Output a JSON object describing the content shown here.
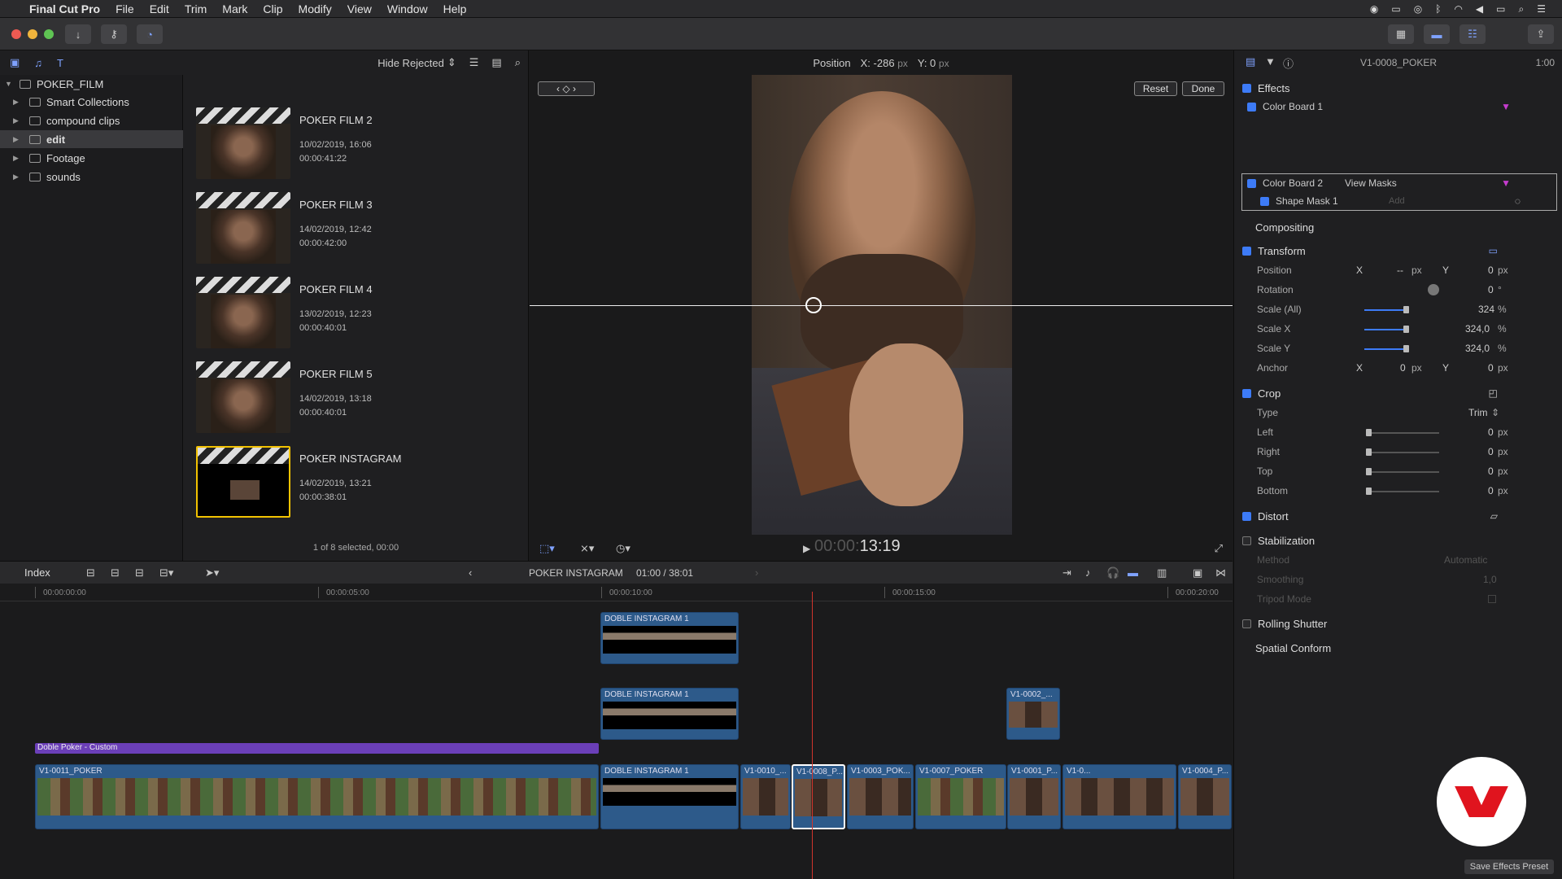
{
  "menubar": {
    "items": [
      "Final Cut Pro",
      "File",
      "Edit",
      "Trim",
      "Mark",
      "Clip",
      "Modify",
      "View",
      "Window",
      "Help"
    ]
  },
  "browser": {
    "filter_label": "Hide Rejected",
    "library": {
      "root": "POKER_FILM",
      "items": [
        "Smart Collections",
        "compound clips",
        "edit",
        "Footage",
        "sounds"
      ],
      "selected": "edit"
    },
    "clips": [
      {
        "title": "POKER FILM 2",
        "date": "10/02/2019, 16:06",
        "duration": "00:00:41:22"
      },
      {
        "title": "POKER FILM 3",
        "date": "14/02/2019, 12:42",
        "duration": "00:00:42:00"
      },
      {
        "title": "POKER FILM 4",
        "date": "13/02/2019, 12:23",
        "duration": "00:00:40:01"
      },
      {
        "title": "POKER FILM 5",
        "date": "14/02/2019, 13:18",
        "duration": "00:00:40:01"
      },
      {
        "title": "POKER INSTAGRAM",
        "date": "14/02/2019, 13:21",
        "duration": "00:00:38:01"
      }
    ],
    "footer": "1 of 8 selected, 00:00"
  },
  "viewer": {
    "param_label": "Position",
    "x_label": "X: -286",
    "x_unit": "px",
    "y_label": "Y: 0",
    "y_unit": "px",
    "reset_label": "Reset",
    "done_label": "Done",
    "timecode_dim": "00:00:",
    "timecode": "13:19"
  },
  "inspector": {
    "clip_name": "V1-0008_POKER",
    "time": "1:00",
    "effects_label": "Effects",
    "color_board_1": "Color Board 1",
    "color_board_2": "Color Board 2",
    "view_masks": "View Masks",
    "shape_mask": "Shape Mask 1",
    "add_label": "Add",
    "compositing": "Compositing",
    "transform": "Transform",
    "position": "Position",
    "x": "X",
    "y": "Y",
    "pos_x": "--",
    "pos_y": "0",
    "rotation": "Rotation",
    "rotation_val": "0",
    "deg": "°",
    "scale_all": "Scale (All)",
    "scale_all_val": "324",
    "scale_x": "Scale X",
    "scale_x_val": "324,0",
    "scale_y": "Scale Y",
    "scale_y_val": "324,0",
    "pct": "%",
    "px": "px",
    "anchor": "Anchor",
    "anchor_x": "0",
    "anchor_y": "0",
    "crop": "Crop",
    "type": "Type",
    "type_val": "Trim",
    "left": "Left",
    "right": "Right",
    "top": "Top",
    "bottom": "Bottom",
    "zero": "0",
    "distort": "Distort",
    "stabilization": "Stabilization",
    "method": "Method",
    "method_val": "Automatic",
    "smoothing": "Smoothing",
    "smoothing_val": "1,0",
    "tripod": "Tripod Mode",
    "rolling": "Rolling Shutter",
    "spatial": "Spatial Conform",
    "save_preset": "Save Effects Preset"
  },
  "timeline": {
    "index_label": "Index",
    "project": "POKER INSTAGRAM",
    "duration": "01:00 / 38:01",
    "ruler": [
      "00:00:00:00",
      "00:00:05:00",
      "00:00:10:00",
      "00:00:15:00",
      "00:00:20:00"
    ],
    "title_clip": "Doble Poker - Custom",
    "clips": {
      "c_doble1": "DOBLE INSTAGRAM 1",
      "c_doble2": "DOBLE INSTAGRAM 1",
      "c_doble3": "DOBLE INSTAGRAM 1",
      "c_0011": "V1-0011_POKER",
      "c_0010": "V1-0010_...",
      "c_0008": "V1-0008_P...",
      "c_0003": "V1-0003_POK...",
      "c_0007": "V1-0007_POKER",
      "c_0001": "V1-0001_P...",
      "c_0x": "V1-0...",
      "c_0004": "V1-0004_P...",
      "c_0002": "V1-0002_..."
    }
  },
  "colors": {
    "accent": "#3d7bf7",
    "playhead": "#d0342c",
    "title_purple": "#6b3fb8",
    "clip_blue": "#2d5a8a",
    "selection_yellow": "#f2c200",
    "logo_red": "#e0141e"
  }
}
